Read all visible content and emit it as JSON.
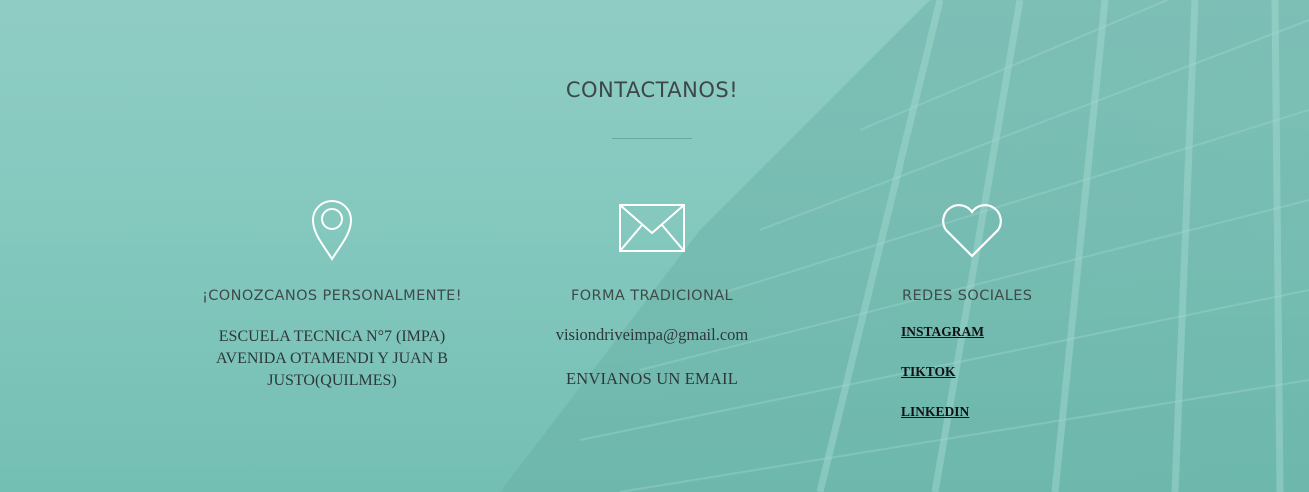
{
  "section": {
    "title": "CONTACTANOS!"
  },
  "location": {
    "icon": "map-pin-icon",
    "heading": "¡CONOZCANOS PERSONALMENTE!",
    "address_lines": [
      "ESCUELA TECNICA N°7 (IMPA)",
      "AVENIDA OTAMENDI Y JUAN B",
      "JUSTO(QUILMES)"
    ]
  },
  "email": {
    "icon": "envelope-icon",
    "heading": "FORMA TRADICIONAL",
    "address": "visiondriveimpa@gmail.com",
    "cta": "ENVIANOS UN EMAIL"
  },
  "social": {
    "icon": "heart-icon",
    "heading": "REDES SOCIALES",
    "links": [
      "INSTAGRAM",
      "TIKTOK",
      "LINKEDIN"
    ]
  },
  "colors": {
    "background_top": "#8fcdc4",
    "background_bottom": "#74bfb4",
    "icon_stroke": "#ffffff",
    "text_dark": "#2e3838"
  }
}
